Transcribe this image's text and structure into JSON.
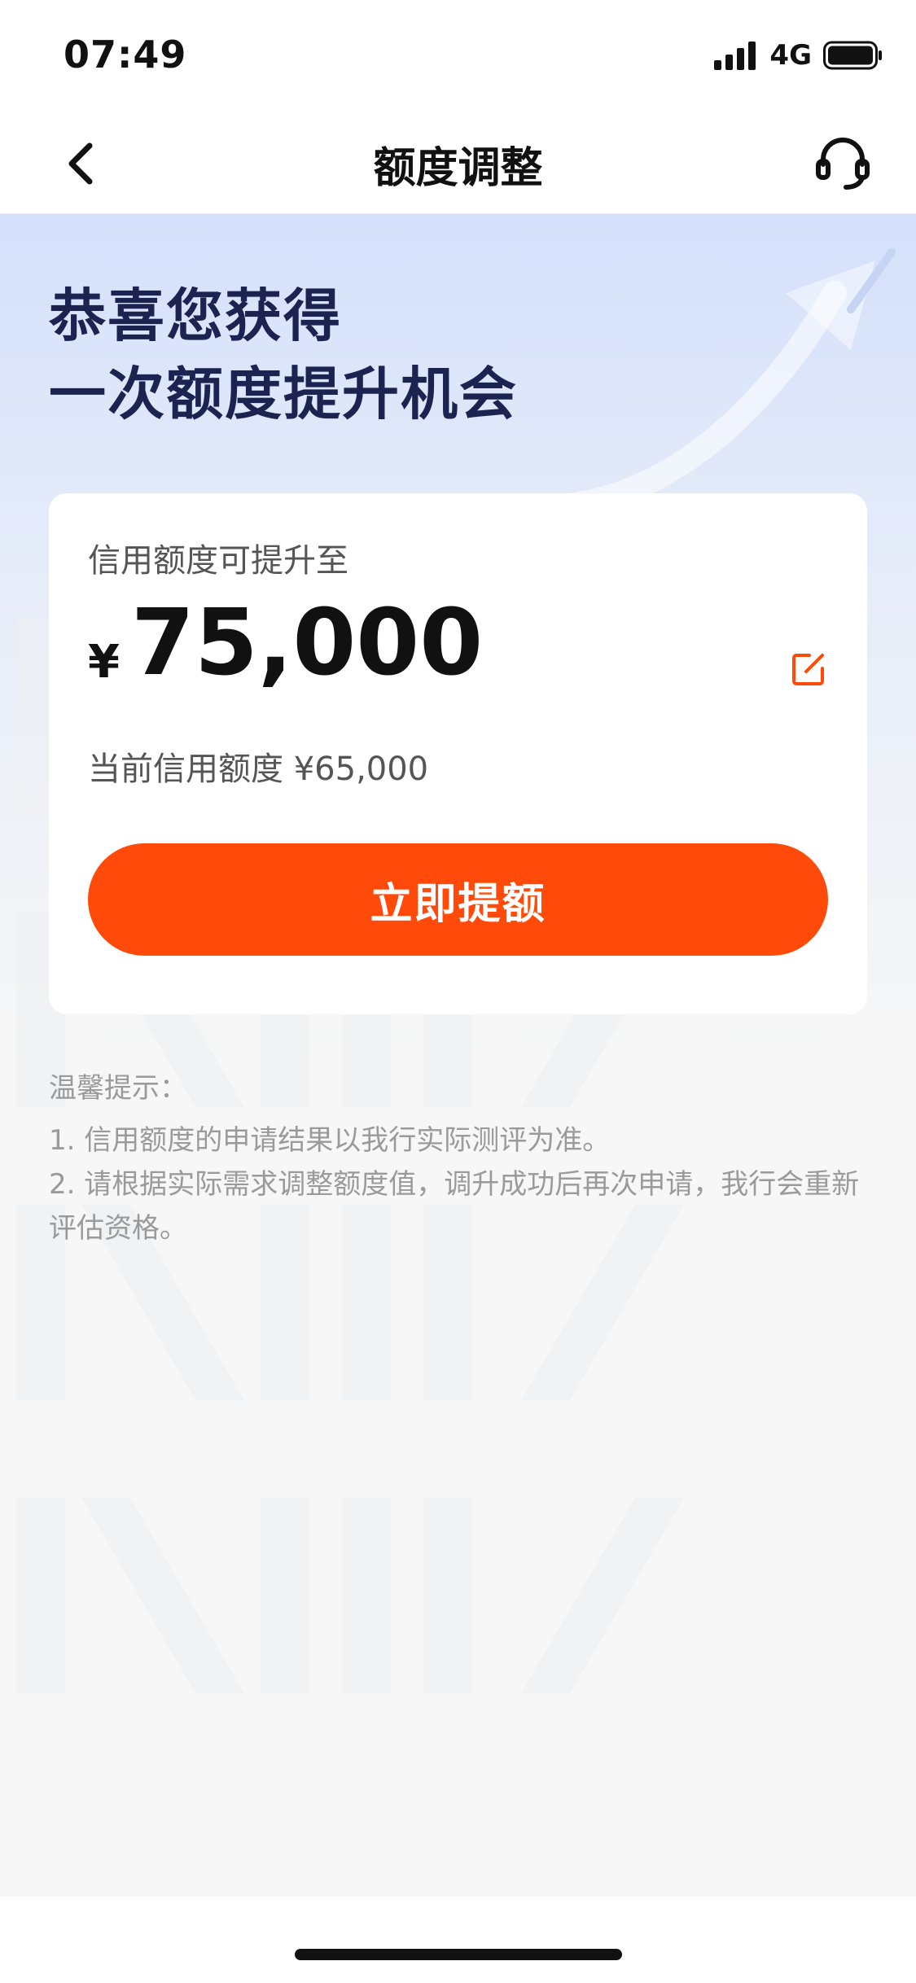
{
  "status_bar": {
    "time": "07:49",
    "network": "4G",
    "icons": [
      "signal-icon",
      "battery-icon"
    ]
  },
  "nav": {
    "title": "额度调整",
    "back_icon": "chevron-left-icon",
    "service_icon": "headset-icon"
  },
  "hero": {
    "line1": "恭喜您获得",
    "line2": "一次额度提升机会"
  },
  "card": {
    "label": "信用额度可提升至",
    "currency": "¥",
    "amount": "75,000",
    "edit_icon": "edit-icon",
    "current_label": "当前信用额度",
    "current_value": "¥65,000",
    "button_label": "立即提额"
  },
  "tips": {
    "title": "温馨提示：",
    "items": [
      "1. 信用额度的申请结果以我行实际测评为准。",
      "2. 请根据实际需求调整额度值，调升成功后再次申请，我行会重新评估资格。"
    ]
  },
  "colors": {
    "accent": "#ff4a0a",
    "hero_text": "#1b2450",
    "hero_bg_top": "#d4e0fb",
    "page_bg": "#f7f7f7"
  }
}
